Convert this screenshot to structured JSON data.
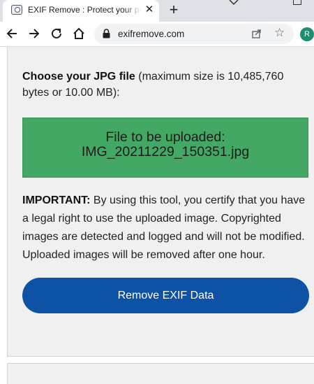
{
  "browser": {
    "tab": {
      "title": "EXIF Remove : Protect your privacy",
      "close_glyph": "✕",
      "favicon": "camera-icon"
    },
    "new_tab_glyph": "+",
    "address": {
      "url": "exifremove.com"
    },
    "profile_initial": "R",
    "colors": {
      "tabstrip": "#dee1e6",
      "avatar": "#1e8e6e"
    }
  },
  "page": {
    "choose": {
      "label_bold": "Choose your JPG file",
      "label_rest": " (maximum size is 10,485,760 bytes or 10.00 MB):"
    },
    "upload": {
      "line1": "File to be uploaded:",
      "filename": "IMG_20211229_150351.jpg",
      "color": "#43a863"
    },
    "important": {
      "label_bold": "IMPORTANT:",
      "text": " By using this tool, you certify that you have a legal right to use the uploaded image. Copyrighted images are detected and logged and will not be modified. Uploaded images will be removed after one hour."
    },
    "remove_button": {
      "label": "Remove EXIF Data",
      "color": "#0d52a5"
    }
  }
}
